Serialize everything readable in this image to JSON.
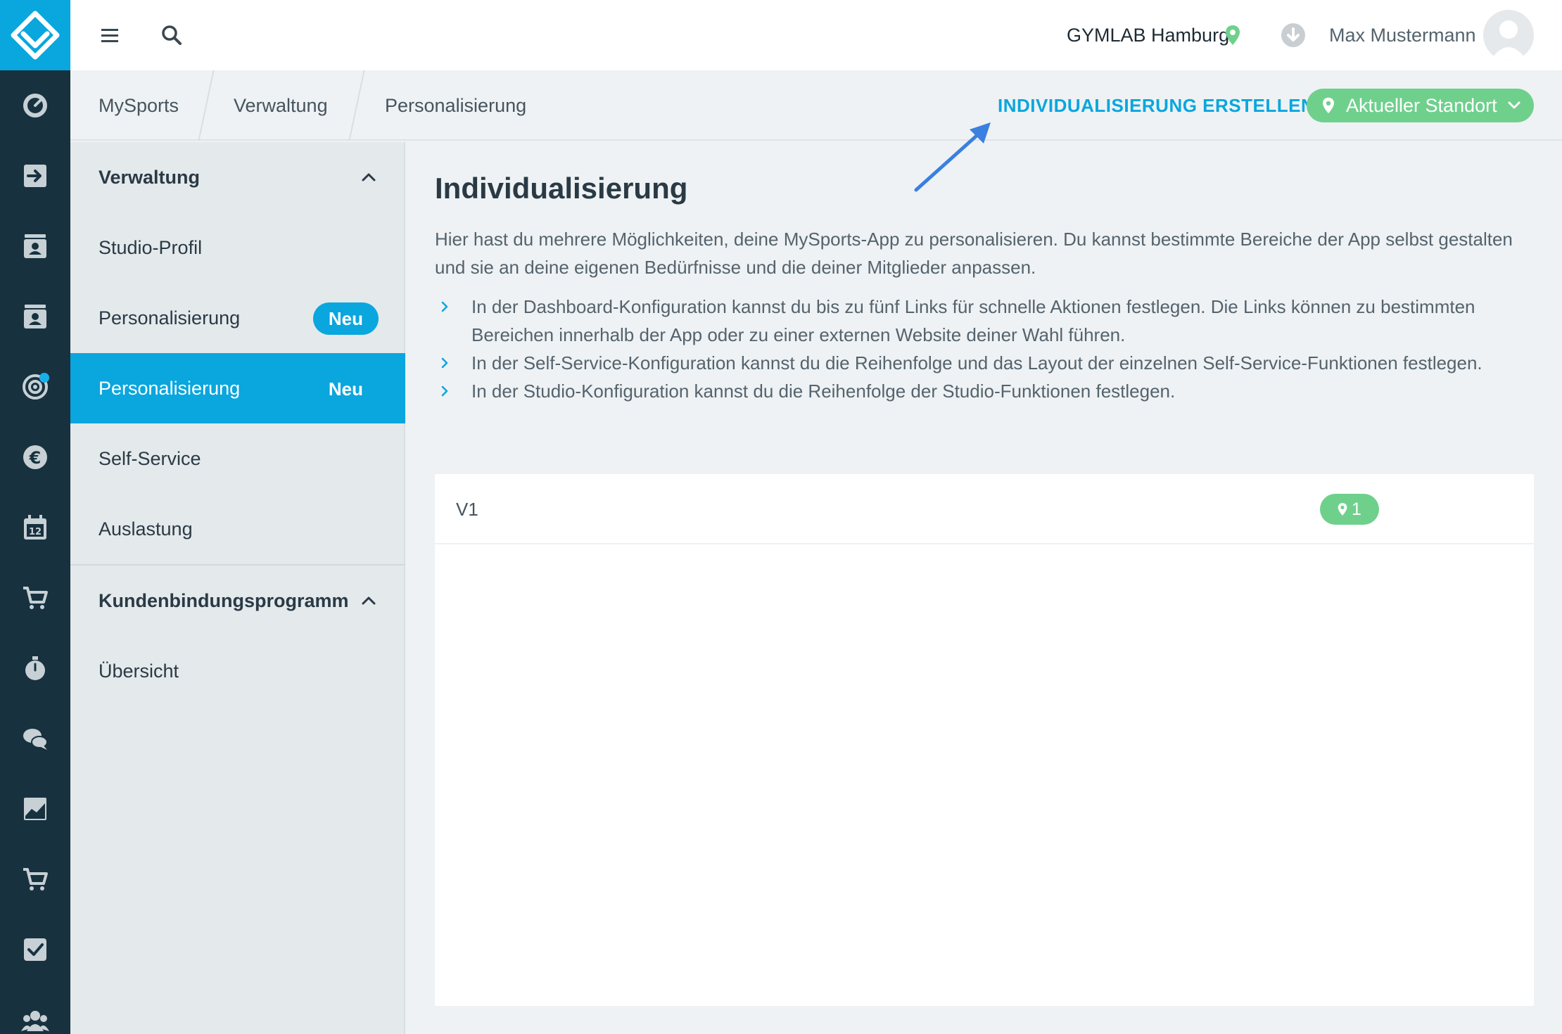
{
  "topbar": {
    "location_name": "GYMLAB Hamburg",
    "user_name": "Max Mustermann"
  },
  "breadcrumb": [
    "MySports",
    "Verwaltung",
    "Personalisierung"
  ],
  "actions": {
    "create_label": "INDIVIDUALISIERUNG ERSTELLEN",
    "location_button_label": "Aktueller Standort"
  },
  "sidebar": {
    "section1_title": "Verwaltung",
    "items": [
      {
        "label": "Studio-Profil"
      },
      {
        "label": "Personalisierung",
        "badge": "Neu"
      },
      {
        "label": "Personalisierung",
        "badge": "Neu",
        "active": true
      },
      {
        "label": "Self-Service"
      },
      {
        "label": "Auslastung"
      }
    ],
    "section2_title": "Kundenbindungsprogramm",
    "items2": [
      {
        "label": "Übersicht"
      }
    ]
  },
  "main": {
    "title": "Individualisierung",
    "intro": "Hier hast du mehrere Möglichkeiten, deine MySports-App zu personalisieren. Du kannst bestimmte Bereiche der App selbst gestalten und sie an deine eigenen Bedürfnisse und die deiner Mitglieder anpassen.",
    "bullets": [
      "In der Dashboard-Konfiguration kannst du bis zu fünf Links für schnelle Aktionen festlegen. Die Links können zu bestimmten Bereichen innerhalb der App oder zu einer externen Website deiner Wahl führen.",
      "In der Self-Service-Konfiguration kannst du die Reihenfolge und das Layout der einzelnen Self-Service-Funktionen festlegen.",
      "In der Studio-Konfiguration kannst du die Reihenfolge der Studio-Funktionen festlegen."
    ],
    "rows": [
      {
        "name": "V1",
        "location_count": "1"
      }
    ]
  },
  "colors": {
    "accent": "#0aa6de",
    "rail": "#17313f",
    "green": "#6fd08c",
    "arrow": "#3b7fe0"
  },
  "rail_icons": [
    "dashboard-icon",
    "check-in-icon",
    "members-icon",
    "contracts-icon",
    "goals-icon",
    "finance-icon",
    "calendar-icon",
    "shop-icon",
    "timer-icon",
    "chat-icon",
    "analytics-icon",
    "cart-icon",
    "tasks-icon",
    "groups-icon"
  ]
}
